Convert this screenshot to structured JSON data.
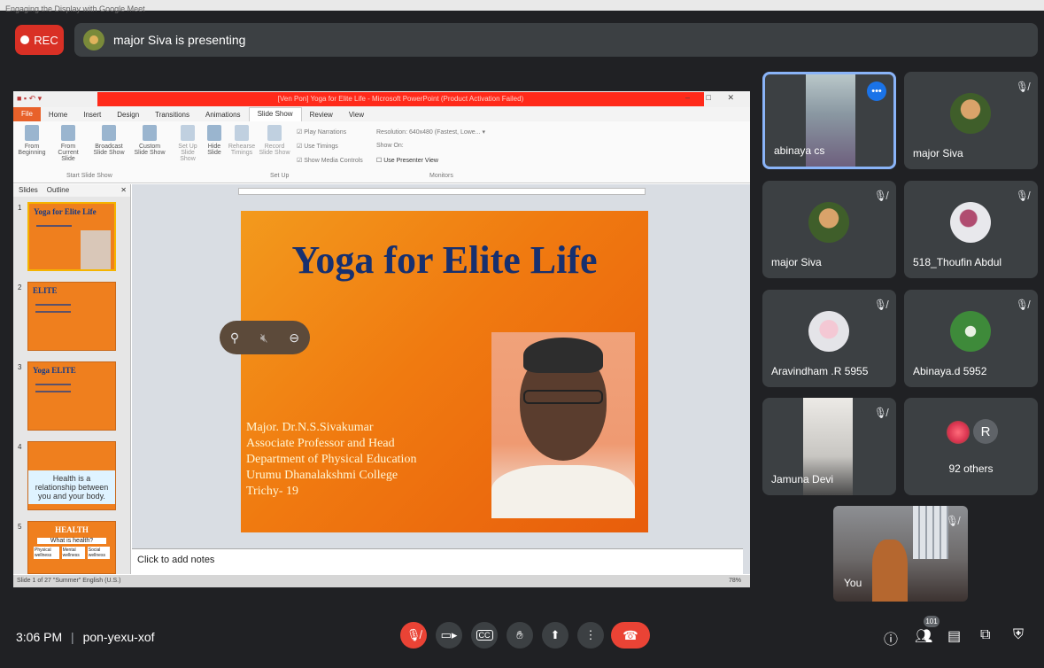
{
  "window_caption": "Engaging the Display with Google Meet",
  "rec_label": "REC",
  "presenting_text": "major Siva is presenting",
  "powerpoint": {
    "title": "[Ven Pon] Yoga for Elite Life - Microsoft PowerPoint (Product Activation Failed)",
    "tabs": [
      "File",
      "Home",
      "Insert",
      "Design",
      "Transitions",
      "Animations",
      "Slide Show",
      "Review",
      "View"
    ],
    "active_tab": "Slide Show",
    "ribbon": {
      "buttons": [
        "From Beginning",
        "From Current Slide",
        "Broadcast Slide Show",
        "Custom Slide Show",
        "Set Up Slide Show",
        "Hide Slide",
        "Rehearse Timings",
        "Record Slide Show"
      ],
      "checks": [
        "Play Narrations",
        "Use Timings",
        "Show Media Controls"
      ],
      "monitor": [
        "Resolution: 640x480 (Fastest, Lowe...",
        "Show On:",
        "Use Presenter View"
      ],
      "groups": [
        "Start Slide Show",
        "Set Up",
        "Monitors"
      ]
    },
    "left_tabs": [
      "Slides",
      "Outline"
    ],
    "thumbnails": [
      {
        "num": "1",
        "title": "Yoga for Elite Life"
      },
      {
        "num": "2",
        "title": "ELITE"
      },
      {
        "num": "3",
        "title": "Yoga ELITE"
      },
      {
        "num": "4",
        "title": "Health is a relationship between you and your body."
      },
      {
        "num": "5",
        "title": "HEALTH",
        "sub": "What is health?",
        "boxes": [
          "Physical wellness",
          "Mental wellness",
          "Social wellness"
        ]
      }
    ],
    "slide": {
      "title": "Yoga for Elite Life",
      "lines": [
        "Major. Dr.N.S.Sivakumar",
        "Associate Professor and Head",
        "Department of Physical Education",
        "Urumu Dhanalakshmi College",
        "Trichy- 19"
      ]
    },
    "notes_placeholder": "Click to add notes",
    "status": "Slide 1 of 27   \"Summer\"   English (U.S.)",
    "zoom": "78%"
  },
  "participants": [
    {
      "name": "abinaya cs",
      "status": "more-options"
    },
    {
      "name": "major Siva",
      "status": "muted"
    },
    {
      "name": "major Siva",
      "status": "muted"
    },
    {
      "name": "518_Thoufin Abdul",
      "status": "muted"
    },
    {
      "name": "Aravindham .R 5955",
      "status": "muted"
    },
    {
      "name": "Abinaya.d 5952",
      "status": "muted"
    },
    {
      "name": "Jamuna Devi",
      "status": "muted"
    },
    {
      "name": "92 others",
      "initial": "R"
    }
  ],
  "self_tile": {
    "name": "You"
  },
  "meeting": {
    "time": "3:06 PM",
    "separator": "|",
    "code": "pon-yexu-xof"
  },
  "people_badge": "101",
  "colors": {
    "rec": "#d93025",
    "hangup": "#ea4335",
    "accent": "#8ab4f8",
    "background": "#202124",
    "tile": "#3c4043"
  }
}
